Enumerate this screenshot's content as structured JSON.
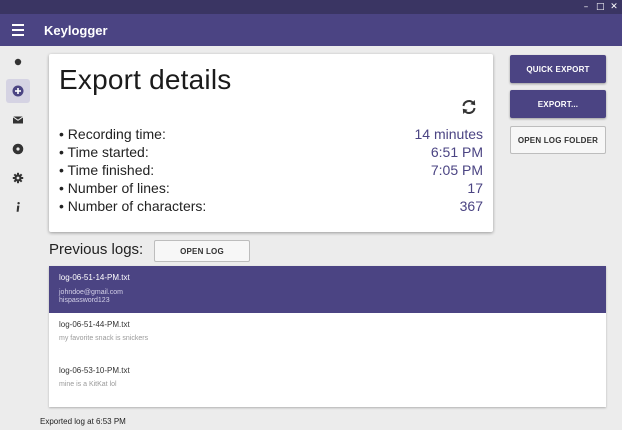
{
  "window": {
    "controls": {
      "minimize": "–",
      "maximize": "□",
      "close": "✕"
    }
  },
  "appbar": {
    "title": "Keylogger",
    "menu_icon": "hamburger-menu-icon"
  },
  "sidebar": {
    "items": [
      {
        "icon": "record-dot-icon",
        "active": false
      },
      {
        "icon": "add-circle-icon",
        "active": true
      },
      {
        "icon": "mail-icon",
        "active": false
      },
      {
        "icon": "help-circle-icon",
        "active": false
      },
      {
        "icon": "settings-gear-icon",
        "active": false
      },
      {
        "icon": "info-icon",
        "active": false
      }
    ]
  },
  "export_card": {
    "title": "Export details",
    "refresh_icon": "refresh-icon",
    "details": [
      {
        "label": "• Recording time:",
        "value": "14 minutes"
      },
      {
        "label": "• Time started:",
        "value": "6:51 PM"
      },
      {
        "label": "• Time finished:",
        "value": "7:05 PM"
      },
      {
        "label": "• Number of lines:",
        "value": "17"
      },
      {
        "label": "• Number of characters:",
        "value": "367"
      }
    ]
  },
  "actions": {
    "quick_export": "QUICK EXPORT",
    "export": "EXPORT...",
    "open_log_folder": "OPEN LOG FOLDER"
  },
  "previous_logs": {
    "label": "Previous logs:",
    "open_log": "OPEN LOG",
    "items": [
      {
        "name": "log-06-51-14-PM.txt",
        "lines": [
          "johndoe@gmail.com",
          "hispassword123"
        ],
        "selected": true
      },
      {
        "name": "log-06-51-44-PM.txt",
        "lines": [
          "my favorite snack is snickers"
        ],
        "selected": false
      },
      {
        "name": "log-06-53-10-PM.txt",
        "lines": [
          "mine is a KitKat lol"
        ],
        "selected": false
      }
    ]
  },
  "status": "Exported log at 6:53 PM",
  "colors": {
    "primary": "#4b4483",
    "titlebar": "#3a3563",
    "background": "#ececec"
  }
}
